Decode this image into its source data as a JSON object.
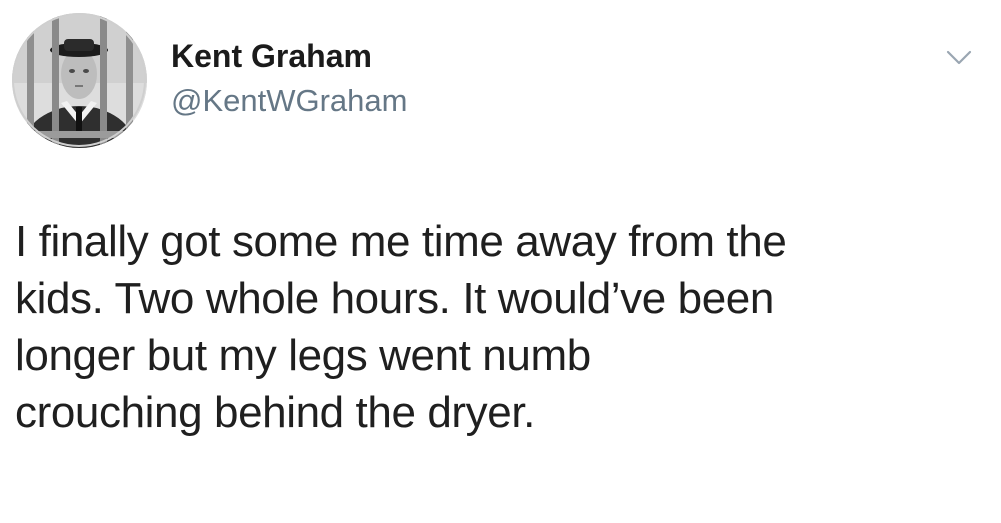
{
  "tweet": {
    "author": {
      "display_name": "Kent Graham",
      "handle": "@KentWGraham"
    },
    "text_lines": [
      "I finally got some me time away from the",
      "kids. Two whole hours. It would’ve been",
      "longer but my legs went numb",
      "crouching behind the dryer."
    ]
  },
  "icons": {
    "avatar": "profile-photo-man-behind-bars",
    "menu": "chevron-down-icon"
  },
  "colors": {
    "background": "#ffffff",
    "name": "#1b1b1b",
    "handle": "#657786",
    "text": "#1f1f1f"
  }
}
